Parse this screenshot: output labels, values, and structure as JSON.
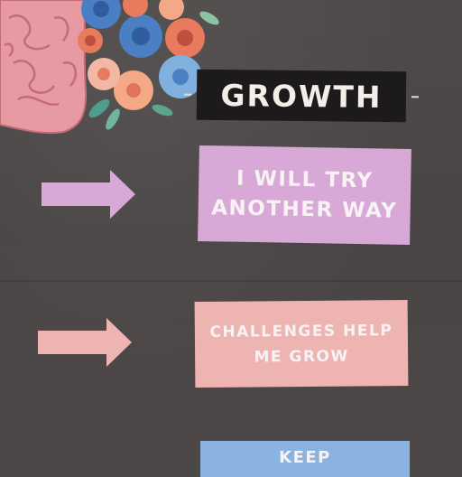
{
  "banner": {
    "title": "GROWTH"
  },
  "cards": [
    {
      "text": "I WILL TRY\nANOTHER WAY",
      "color": "#d8a9d7"
    },
    {
      "text": "CHALLENGES HELP\nME GROW",
      "color": "#eeb4b2"
    },
    {
      "text": "KEEP",
      "color": "#8ab3e0"
    }
  ],
  "arrows": [
    {
      "color": "#d8a9d7"
    },
    {
      "color": "#eeb4b2"
    }
  ],
  "decor": {
    "brain_color": "#e89aa2",
    "flower_colors": [
      "#4a7fc4",
      "#e87a5d",
      "#f1b8a4",
      "#7fb0de",
      "#f4a986"
    ]
  }
}
